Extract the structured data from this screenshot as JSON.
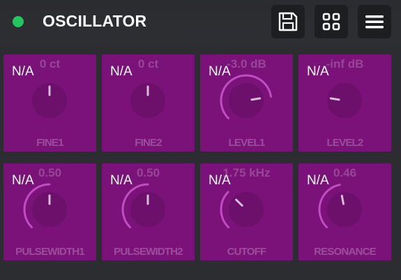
{
  "header": {
    "status_color": "#22c55e",
    "title": "OSCILLATOR",
    "buttons": [
      {
        "name": "save-button",
        "icon": "floppy-disk-icon"
      },
      {
        "name": "grid-view-button",
        "icon": "grid-icon"
      },
      {
        "name": "menu-button",
        "icon": "hamburger-menu-icon"
      }
    ]
  },
  "controls": [
    {
      "id": "fine1",
      "status": "N/A",
      "value": "0 ct",
      "label": "FINE1",
      "level": 0.5,
      "arc": false
    },
    {
      "id": "fine2",
      "status": "N/A",
      "value": "0 ct",
      "label": "FINE2",
      "level": 0.5,
      "arc": false
    },
    {
      "id": "level1",
      "status": "N/A",
      "value": "-3.0 dB",
      "label": "LEVEL1",
      "level": 0.8,
      "arc": true
    },
    {
      "id": "level2",
      "status": "N/A",
      "value": "-inf dB",
      "label": "LEVEL2",
      "level": 0.2,
      "arc": false
    },
    {
      "id": "pulsewidth1",
      "status": "N/A",
      "value": "0.50",
      "label": "PULSEWIDTH1",
      "level": 0.5,
      "arc": true
    },
    {
      "id": "pulsewidth2",
      "status": "N/A",
      "value": "0.50",
      "label": "PULSEWIDTH2",
      "level": 0.5,
      "arc": true
    },
    {
      "id": "cutoff",
      "status": "N/A",
      "value": "1.75 kHz",
      "label": "CUTOFF",
      "level": 0.33,
      "arc": true
    },
    {
      "id": "resonance",
      "status": "N/A",
      "value": "0.46",
      "label": "RESONANCE",
      "level": 0.46,
      "arc": true
    }
  ],
  "colors": {
    "tile": "#7a127a",
    "arc": "#c24dc2",
    "knob": "#6c106c"
  }
}
